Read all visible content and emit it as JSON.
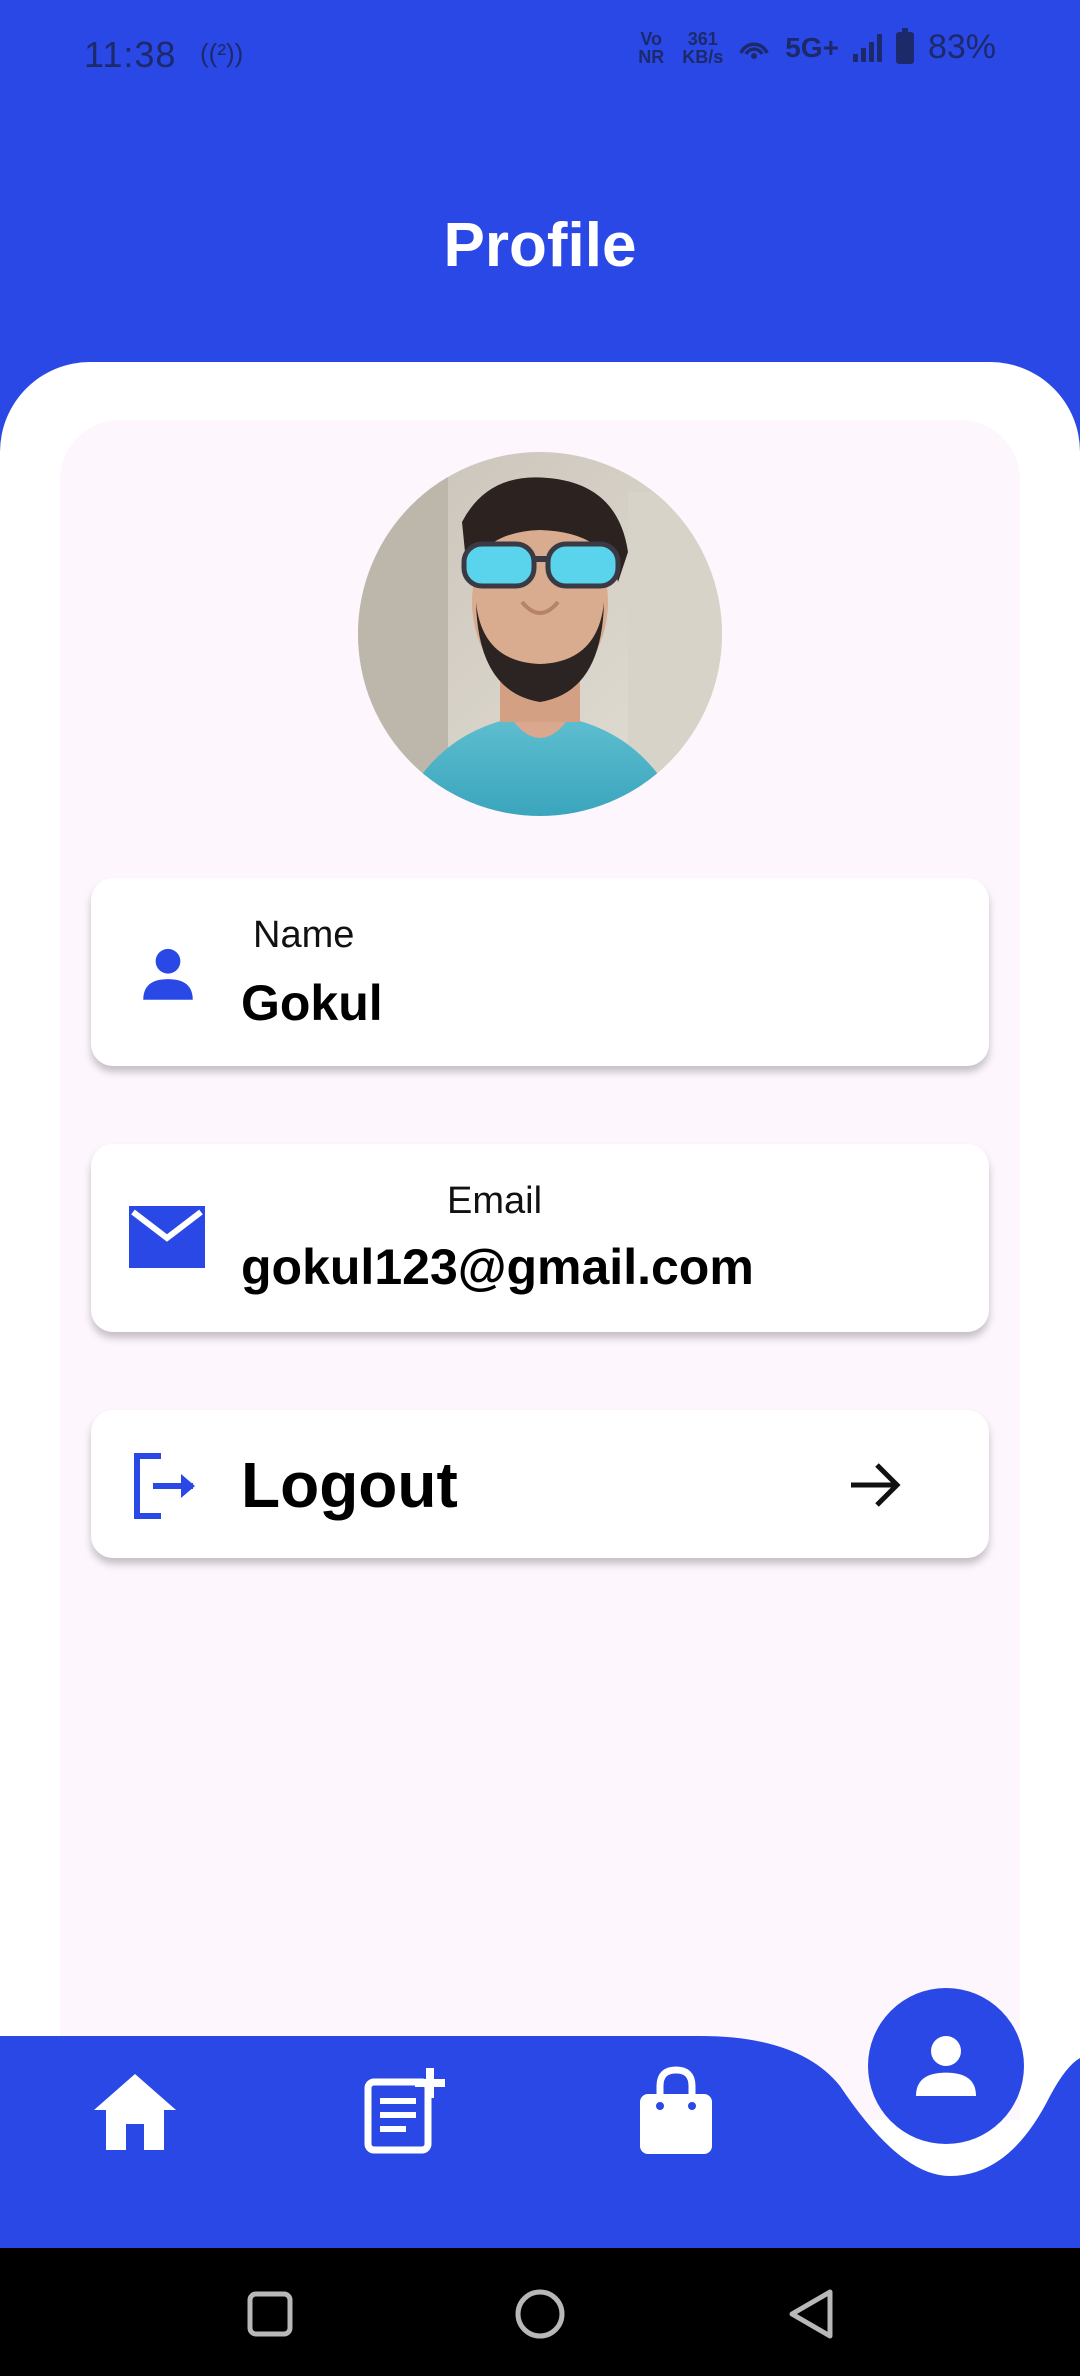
{
  "status_bar": {
    "time": "11:38",
    "radio_glyph": "((²))",
    "vonr": [
      "Vo",
      "NR"
    ],
    "speed": [
      "361",
      "KB/s"
    ],
    "network": "5G+",
    "battery": "83%"
  },
  "header": {
    "title": "Profile"
  },
  "profile": {
    "avatar_icon": "person-with-sunglasses-photo",
    "name_label": "Name",
    "name_value": "Gokul",
    "email_label": "Email",
    "email_value": "gokul123@gmail.com",
    "logout_label": "Logout"
  },
  "bottom_nav": {
    "items": [
      "home-icon",
      "add-note-icon",
      "shopping-bag-icon",
      "profile-icon"
    ],
    "active": "profile-icon"
  },
  "colors": {
    "primary": "#2a48e5",
    "card_bg": "#fdf6fd",
    "status_text": "#1c2a6b"
  }
}
